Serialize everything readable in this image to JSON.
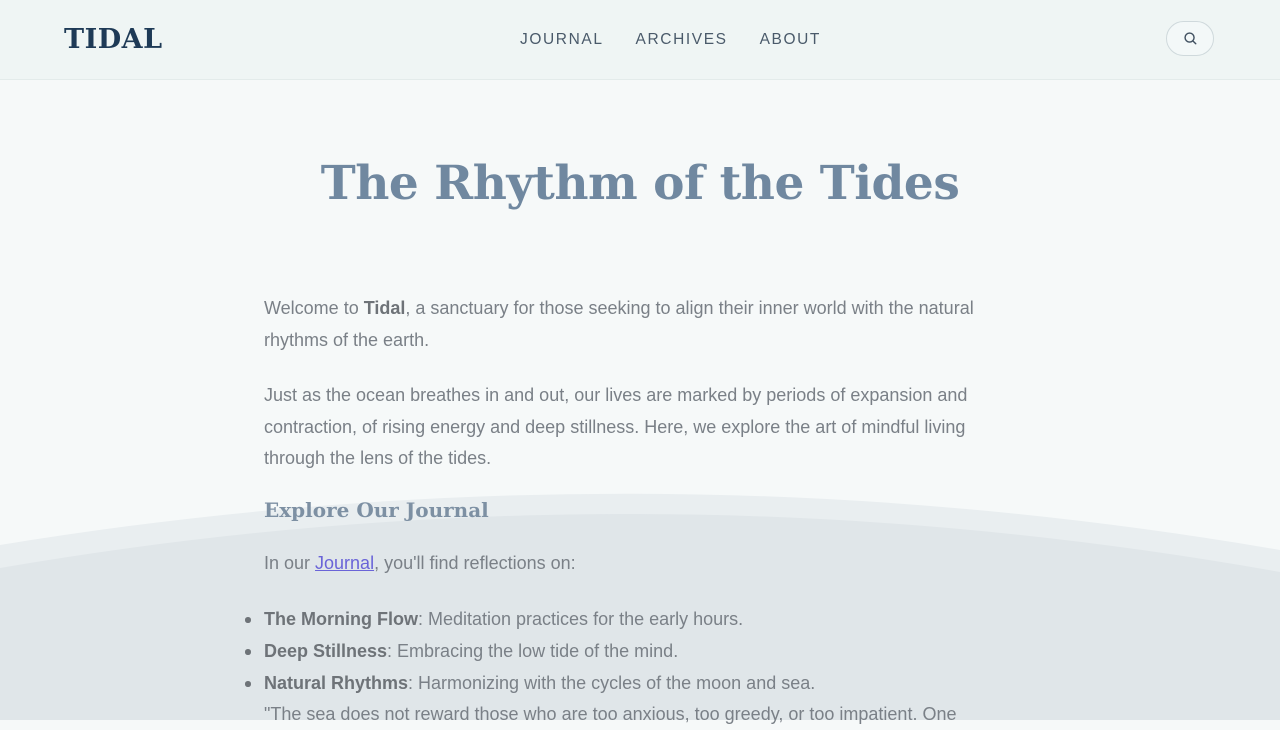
{
  "header": {
    "logo": "TIDAL",
    "nav": [
      {
        "label": "JOURNAL"
      },
      {
        "label": "ARCHIVES"
      },
      {
        "label": "ABOUT"
      }
    ],
    "search_icon": "search-icon"
  },
  "main": {
    "title": "The Rhythm of the Tides",
    "intro": {
      "pre": "Welcome to ",
      "bold": "Tidal",
      "post": ", a sanctuary for those seeking to align their inner world with the natural rhythms of the earth."
    },
    "paragraph2": "Just as the ocean breathes in and out, our lives are marked by periods of expansion and contraction, of rising energy and deep stillness. Here, we explore the art of mindful living through the lens of the tides.",
    "subheading": "Explore Our Journal",
    "journal_line": {
      "pre": "In our ",
      "link": "Journal",
      "post": ", you'll find reflections on:"
    },
    "items": [
      {
        "bold": "The Morning Flow",
        "text": ": Meditation practices for the early hours."
      },
      {
        "bold": "Deep Stillness",
        "text": ": Embracing the low tide of the mind."
      },
      {
        "bold": "Natural Rhythms",
        "text": ": Harmonizing with the cycles of the moon and sea."
      }
    ],
    "quote": "\"The sea does not reward those who are too anxious, too greedy, or too impatient. One"
  },
  "colors": {
    "logo": "#1e3a56",
    "title": "#7088a0",
    "body_text": "#7a8087",
    "link": "#6a64d8",
    "wave": "#e0e6e9"
  }
}
